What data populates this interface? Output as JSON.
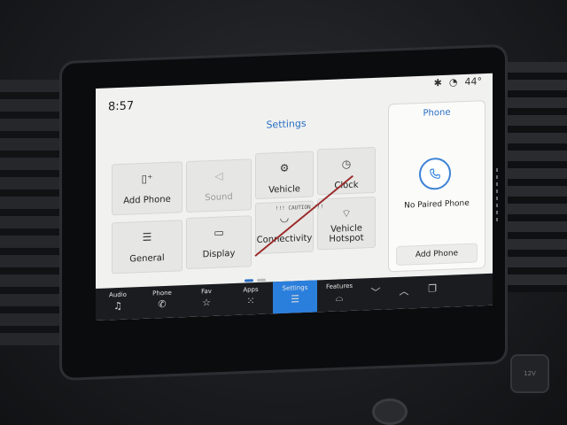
{
  "status": {
    "time": "8:57",
    "temperature": "44°"
  },
  "settings": {
    "title": "Settings",
    "tiles": [
      {
        "label": "Add Phone",
        "icon": "add-phone-icon"
      },
      {
        "label": "Sound",
        "icon": "speaker-icon",
        "disabled": true
      },
      {
        "label": "Vehicle",
        "icon": "vehicle-icon"
      },
      {
        "label": "Clock",
        "icon": "clock-icon"
      },
      {
        "label": "General",
        "icon": "sliders-icon"
      },
      {
        "label": "Display",
        "icon": "display-icon"
      },
      {
        "label": "Connectivity",
        "icon": "wifi-icon"
      },
      {
        "label": "Vehicle Hotspot",
        "icon": "hotspot-icon"
      }
    ],
    "caution_text": "!!! CAUTION !!!"
  },
  "phone_panel": {
    "title": "Phone",
    "status": "No Paired Phone",
    "add_button": "Add Phone"
  },
  "navbar": [
    {
      "label": "Audio",
      "icon": "music-note-icon"
    },
    {
      "label": "Phone",
      "icon": "phone-icon"
    },
    {
      "label": "Fav",
      "icon": "star-icon"
    },
    {
      "label": "Apps",
      "icon": "apps-grid-icon"
    },
    {
      "label": "Settings",
      "icon": "sliders-icon",
      "active": true
    },
    {
      "label": "Features",
      "icon": "car-icon"
    }
  ],
  "port_label": "12V",
  "accent": "#2b7fdc"
}
